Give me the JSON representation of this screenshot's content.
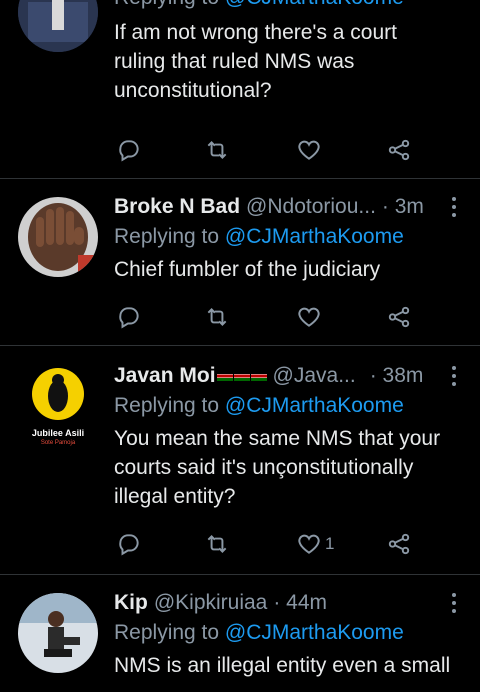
{
  "tweets": [
    {
      "reply_prefix": "Replying to",
      "mention": "@CJMarthaKoome",
      "text": "If am not wrong there's a court ruling that ruled NMS was unconstitutional?",
      "likes": ""
    },
    {
      "name": "Broke N Bad",
      "handle": "@Ndotoriou...",
      "time": "· 3m",
      "reply_prefix": "Replying to",
      "mention": "@CJMarthaKoome",
      "text": "Chief fumbler of the judiciary",
      "likes": ""
    },
    {
      "name": "Javan Moi",
      "handle": "@Java...",
      "time": "· 38m",
      "reply_prefix": "Replying to",
      "mention": "@CJMarthaKoome",
      "text": "You mean the same NMS that your courts said it's unçonstitutionally illegal entity?",
      "likes": "1",
      "avatar_text_1": "Jubilee Asili",
      "avatar_text_2": "Sote Pamoja"
    },
    {
      "name": "Kip",
      "handle": "@Kipkiruiaa",
      "time": "· 44m",
      "reply_prefix": "Replying to",
      "mention": "@CJMarthaKoome",
      "text": "NMS is an illegal entity even a small"
    }
  ],
  "colors": {
    "background": "#000000",
    "text": "#e7e9ea",
    "muted": "#8b98a5",
    "link": "#1d9bf0",
    "divider": "#2f3336"
  }
}
